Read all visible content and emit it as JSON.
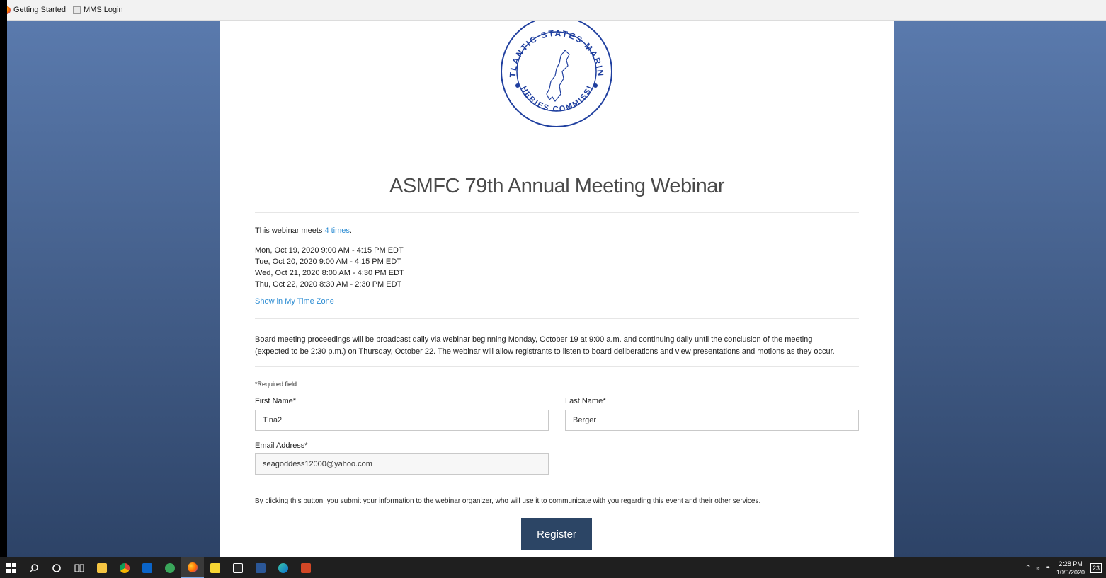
{
  "bookmarks": [
    {
      "label": "Getting Started",
      "icon": "firefox-icon"
    },
    {
      "label": "MMS Login",
      "icon": "page-icon"
    }
  ],
  "seal": {
    "top_text": "ATLANTIC STATES MARINE",
    "bottom_text": "FISHERIES COMMISSION"
  },
  "page": {
    "title": "ASMFC 79th Annual Meeting Webinar",
    "meets_prefix": "This webinar meets ",
    "meets_link": "4 times",
    "meets_suffix": ".",
    "sessions": [
      "Mon, Oct 19, 2020 9:00 AM - 4:15 PM EDT",
      "Tue, Oct 20, 2020 9:00 AM - 4:15 PM EDT",
      "Wed, Oct 21, 2020 8:00 AM - 4:30 PM EDT",
      "Thu, Oct 22, 2020 8:30 AM - 2:30 PM EDT"
    ],
    "timezone_link": "Show in My Time Zone",
    "description_line1": "Board meeting proceedings will be broadcast daily via webinar beginning Monday, October 19 at  9:00 a.m. and continuing daily until the conclusion of the meeting",
    "description_line2": "(expected to be 2:30 p.m.) on Thursday, October 22. The webinar will allow registrants to listen to board deliberations and view presentations and motions as they occur."
  },
  "form": {
    "required_note": "*Required field",
    "first_name_label": "First Name*",
    "first_name_value": "Tina2",
    "last_name_label": "Last Name*",
    "last_name_value": "Berger",
    "email_label": "Email Address*",
    "email_value": "seagoddess12000@yahoo.com",
    "consent_text": "By clicking this button, you submit your information to the webinar organizer, who will use it to communicate with you regarding this event and their other services.",
    "register_label": "Register"
  },
  "taskbar": {
    "time": "2:28 PM",
    "date": "10/5/2020",
    "notification_count": "23"
  },
  "colors": {
    "accent_link": "#2a8bd2",
    "register_button": "#2c4565",
    "seal_blue": "#1f3f9f"
  }
}
